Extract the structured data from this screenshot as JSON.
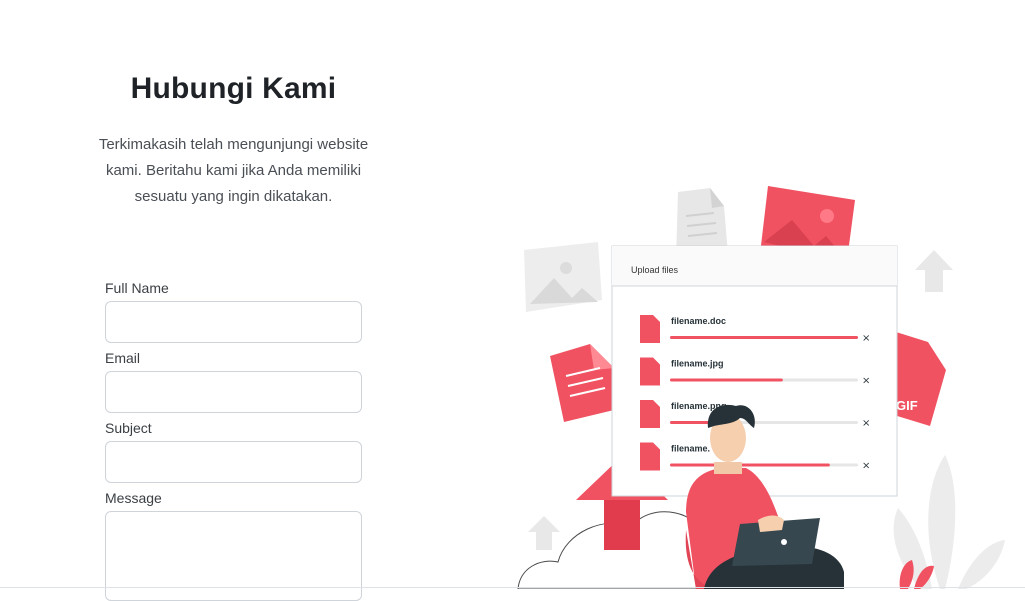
{
  "page": {
    "title": "Hubungi Kami",
    "intro": "Terkimakasih telah mengunjungi website kami. Beritahu kami jika Anda memiliki sesuatu yang ingin dikatakan."
  },
  "form": {
    "full_name_label": "Full Name",
    "full_name_value": "",
    "email_label": "Email",
    "email_value": "",
    "subject_label": "Subject",
    "subject_value": "",
    "message_label": "Message",
    "message_value": ""
  },
  "illustration": {
    "panel_title": "Upload files",
    "files": [
      {
        "name": "filename.doc",
        "progress": 1.0
      },
      {
        "name": "filename.jpg",
        "progress": 0.6
      },
      {
        "name": "filename.png",
        "progress": 0.3
      },
      {
        "name": "filename.",
        "progress": 0.85
      }
    ],
    "badge_gif": "GIF",
    "accent_color": "#f05262",
    "icons": [
      "document-icon",
      "image-icon",
      "arrow-up-icon",
      "close-icon"
    ]
  }
}
